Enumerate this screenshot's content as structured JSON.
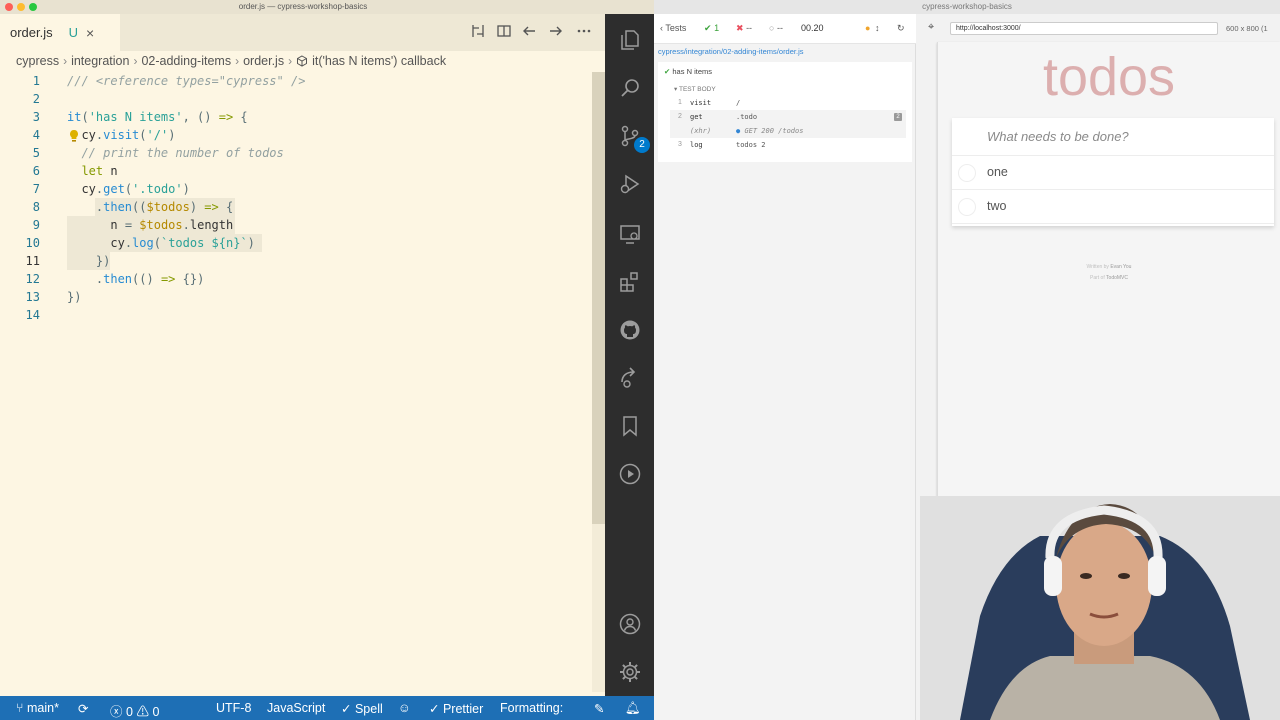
{
  "vscode": {
    "window_title": "order.js — cypress-workshop-basics",
    "tab": {
      "filename": "order.js",
      "status": "U",
      "close": "×"
    },
    "breadcrumb": [
      "cypress",
      "integration",
      "02-adding-items",
      "order.js",
      "it('has N items') callback"
    ],
    "code_lines": [
      {
        "n": "1",
        "html": "<span class=\"com\">/// &lt;reference types=\"cypress\" /&gt;</span>"
      },
      {
        "n": "2",
        "html": ""
      },
      {
        "n": "3",
        "html": "<span class=\"fn\">it</span>(<span class=\"str\">'has N items'</span>, () <span class=\"kw\">=&gt;</span> {"
      },
      {
        "n": "4",
        "html": "  <span class=\"plain\">cy</span>.<span class=\"fn\">visit</span>(<span class=\"str\">'/'</span>)"
      },
      {
        "n": "5",
        "html": "  <span class=\"com\">// print the number of todos</span>"
      },
      {
        "n": "6",
        "html": "  <span class=\"kw\">let</span> <span class=\"plain\">n</span>"
      },
      {
        "n": "7",
        "html": "  <span class=\"plain\">cy</span>.<span class=\"fn\">get</span>(<span class=\"str\">'.todo'</span>)"
      },
      {
        "n": "8",
        "html": "    .<span class=\"fn\">then</span>((<span class=\"var\">$todos</span>) <span class=\"kw\">=&gt;</span> {"
      },
      {
        "n": "9",
        "html": "      <span class=\"plain\">n</span> = <span class=\"var\">$todos</span>.<span class=\"plain\">length</span>"
      },
      {
        "n": "10",
        "html": "      <span class=\"plain\">cy</span>.<span class=\"fn\">log</span>(<span class=\"str\">`todos ${n}`</span>)"
      },
      {
        "n": "11",
        "html": "    })"
      },
      {
        "n": "12",
        "html": "    .<span class=\"fn\">then</span>(() <span class=\"kw\">=&gt;</span> {})"
      },
      {
        "n": "13",
        "html": "})"
      },
      {
        "n": "14",
        "html": ""
      }
    ],
    "active_line": "11",
    "activity_badge": "2",
    "statusbar": {
      "branch": "main*",
      "problems": "0",
      "warnings": "0",
      "encoding": "UTF-8",
      "language": "JavaScript",
      "spell": "Spell",
      "prettier": "Prettier",
      "formatting": "Formatting:"
    }
  },
  "cypress": {
    "window_title": "cypress-workshop-basics",
    "reporter": {
      "tests_label": "Tests",
      "passed": "1",
      "failed": "--",
      "pending": "--",
      "duration": "00.20",
      "spec_path": "cypress/integration/02-adding-items/order.js",
      "test_title": "has N items",
      "section": "TEST BODY",
      "commands": [
        {
          "num": "1",
          "name": "visit",
          "msg": "/"
        },
        {
          "num": "2",
          "name": "get",
          "msg": ".todo",
          "count": "2"
        },
        {
          "num": "",
          "name": "(xhr)",
          "msg": "GET 200 /todos"
        },
        {
          "num": "3",
          "name": "log",
          "msg": "todos 2"
        }
      ]
    },
    "aut": {
      "url": "http://localhost:3000/",
      "viewport": "600 x 800 (1",
      "app_title": "todos",
      "placeholder": "What needs to be done?",
      "todos": [
        "one",
        "two"
      ],
      "footer_line1_prefix": "Written by",
      "footer_line1_name": "Evan You",
      "footer_line2_prefix": "Part of",
      "footer_line2_name": "TodoMVC"
    }
  }
}
